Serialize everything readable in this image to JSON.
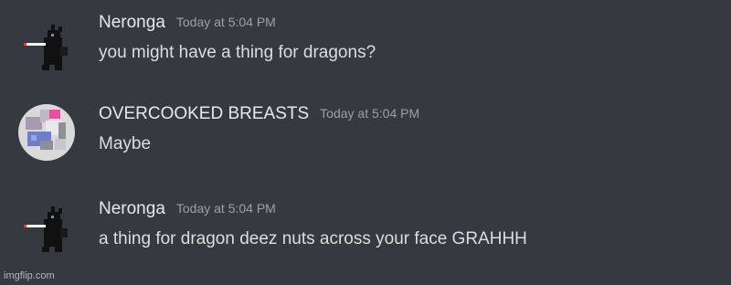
{
  "messages": [
    {
      "username": "Neronga",
      "timestamp": "Today at 5:04 PM",
      "content": "you might have a thing for dragons?",
      "avatar_icon": "black-dragon-smoking-avatar-icon"
    },
    {
      "username": "OVERCOOKED BREASTS",
      "timestamp": "Today at 5:04 PM",
      "content": "Maybe",
      "avatar_icon": "blocky-character-avatar-icon"
    },
    {
      "username": "Neronga",
      "timestamp": "Today at 5:04 PM",
      "content": "a thing for dragon deez nuts across your face GRAHHH",
      "avatar_icon": "black-dragon-smoking-avatar-icon"
    }
  ],
  "watermark": "imgflip.com",
  "colors": {
    "background": "#36393f",
    "username": "#e6e8ea",
    "timestamp": "#9aa0a8",
    "text": "#dcddde"
  }
}
